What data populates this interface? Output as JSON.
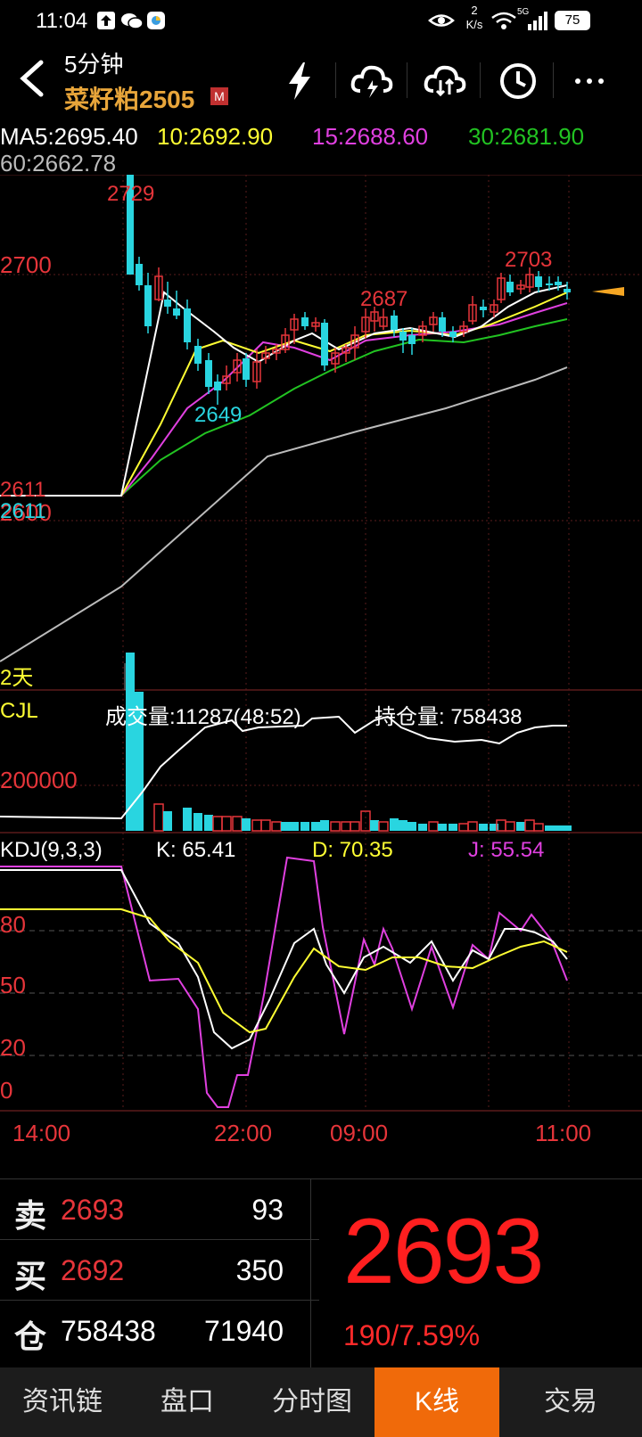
{
  "status_bar": {
    "time": "11:04",
    "net_speed_value": "2",
    "net_speed_unit": "K/s",
    "signal": "5G",
    "battery": "75"
  },
  "header": {
    "period": "5分钟",
    "contract": "菜籽粕2505",
    "badge": "M"
  },
  "ma": {
    "ma5": "MA5:2695.40",
    "ma10": "10:2692.90",
    "ma15": "15:2688.60",
    "ma30": "30:2681.90",
    "ma60": "60:2662.78"
  },
  "price_axis": {
    "level_2700": "2700",
    "level_2600": "2600"
  },
  "annotations": {
    "high_a": "2729",
    "high_b": "2687",
    "high_c": "2703",
    "low_a": "2649",
    "start_a": "2611",
    "start_b": "2611",
    "period_tag": "2天"
  },
  "volume": {
    "label": "CJL",
    "volume_text": "成交量:11287(48:52)",
    "oi_text": "持仓量: 758438",
    "axis_label": "200000"
  },
  "kdj": {
    "label": "KDJ(9,3,3)",
    "k": "K: 65.41",
    "d": "D: 70.35",
    "j": "J: 55.54",
    "levels": [
      "80",
      "50",
      "20",
      "0"
    ]
  },
  "time_axis": [
    "14:00",
    "22:00",
    "09:00",
    "11:00"
  ],
  "quote": {
    "sell": {
      "label": "卖",
      "price": "2693",
      "volume": "93"
    },
    "buy": {
      "label": "买",
      "price": "2692",
      "volume": "350"
    },
    "position": {
      "label": "仓",
      "total": "758438",
      "change": "71940"
    },
    "last_price": "2693",
    "change": "190/7.59%"
  },
  "nav": {
    "items": [
      "资讯链",
      "盘口",
      "分时图",
      "K线",
      "交易"
    ],
    "active_index": 3
  },
  "colors": {
    "up": "#e6353a",
    "down": "#29d5e0",
    "ma5": "#ffffff",
    "ma10": "#ffff33",
    "ma15": "#e040e0",
    "ma30": "#22c322",
    "ma60": "#bbbbbb",
    "accent": "#f06a0a"
  }
}
